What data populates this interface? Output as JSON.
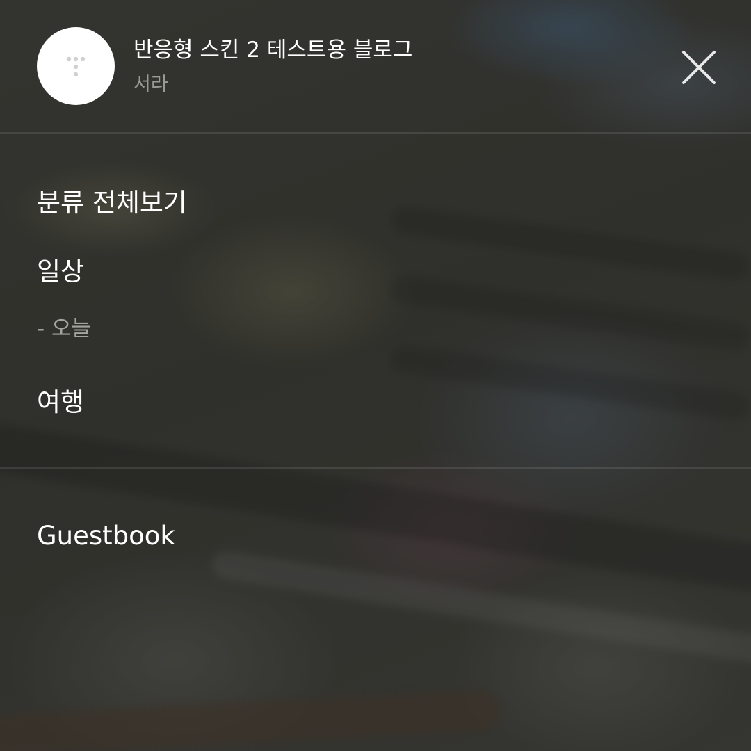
{
  "blog": {
    "title": "반응형 스킨 2 테스트용 블로그",
    "author": "서라"
  },
  "menu": {
    "all_categories": "분류 전체보기",
    "categories": [
      {
        "label": "일상",
        "children": [
          {
            "label": "- 오늘"
          }
        ]
      },
      {
        "label": "여행",
        "children": []
      }
    ],
    "guestbook": "Guestbook"
  },
  "icons": {
    "avatar": "tistory-logo-icon",
    "close": "close-icon"
  },
  "colors": {
    "text_primary": "#ffffff",
    "text_secondary": "#9a9a96",
    "avatar_bg": "#ffffff"
  }
}
